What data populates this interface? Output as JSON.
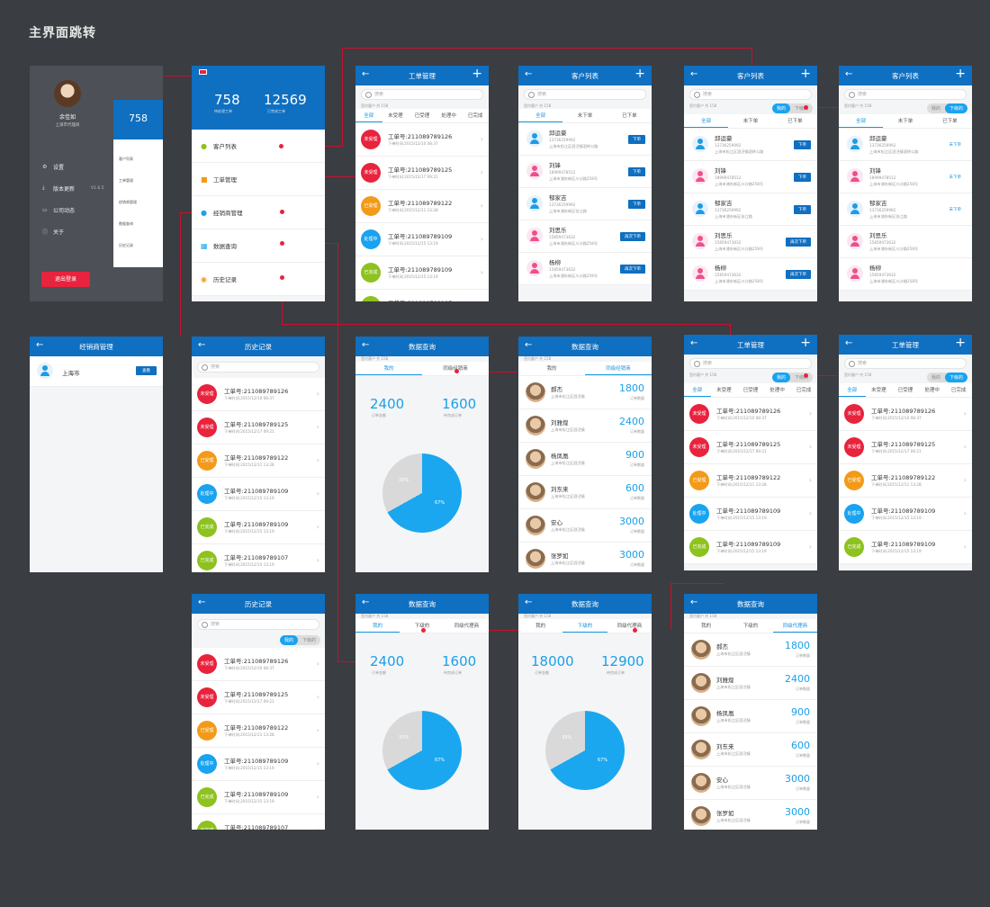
{
  "title": "主界面跳转",
  "side": {
    "name": "余佳如",
    "location": "上海市代理商",
    "menu": [
      {
        "icon": "gear-icon",
        "label": "设置"
      },
      {
        "icon": "download-icon",
        "label": "版本更新",
        "extra": "V1.6.5"
      },
      {
        "icon": "doc-icon",
        "label": "公司动态"
      },
      {
        "icon": "info-icon",
        "label": "关于"
      }
    ],
    "logout": "退出登录",
    "peek_num": "758",
    "peek_items": [
      "客户列表",
      "工单管理",
      "经销商管理",
      "数据查询",
      "历史记录"
    ]
  },
  "home": {
    "stat1": "758",
    "stat1_label": "待处理工单",
    "stat2": "12569",
    "stat2_label": "已完成工单",
    "menu": [
      "客户列表",
      "工单管理",
      "经销商管理",
      "数据查询",
      "历史记录"
    ]
  },
  "titles": {
    "work": "工单管理",
    "customers": "客户列表",
    "dealer": "经销商管理",
    "history": "历史记录",
    "data": "数据查询"
  },
  "search": "搜索",
  "sub_note": "签约客户 共 158",
  "work_tabs": [
    "全部",
    "未受理",
    "已受理",
    "处理中",
    "已完成"
  ],
  "cust_tabs": [
    "全部",
    "未下单",
    "已下单"
  ],
  "seg": [
    "我的",
    "下级的"
  ],
  "data_tabs2": [
    "我的",
    "同级经销商"
  ],
  "data_tabs3": [
    "我的",
    "下级的",
    "同级代理商"
  ],
  "orders": [
    {
      "status": "未受理",
      "no": "工单号:211089789126",
      "date": "下单时间:2015/12/10 08:37"
    },
    {
      "status": "未受理",
      "no": "工单号:211089789125",
      "date": "下单时间:2015/12/17 09:21"
    },
    {
      "status": "已受理",
      "no": "工单号:211089789122",
      "date": "下单时间:2015/12/11 13:28"
    },
    {
      "status": "处理中",
      "no": "工单号:211089789109",
      "date": "下单时间:2015/12/15 13:19"
    },
    {
      "status": "已完成",
      "no": "工单号:211089789109",
      "date": "下单时间:2015/12/15 13:19"
    },
    {
      "status": "已完成",
      "no": "工单号:211089789107",
      "date": "下单时间:2015/12/15 13:19"
    }
  ],
  "customers": [
    {
      "name": "邱运豪",
      "phone": "13736259992",
      "addr": "上海市松江区泗泾镇泗砖公路",
      "btn": "下单",
      "g": "m"
    },
    {
      "name": "刘锋",
      "phone": "18999478512",
      "addr": "上海市浦东新区川沙路258号",
      "btn": "下单",
      "g": "f"
    },
    {
      "name": "郁家吉",
      "phone": "13736259992",
      "addr": "上海市浦东新区张江路",
      "btn": "下单",
      "g": "m"
    },
    {
      "name": "刘思乐",
      "phone": "15859473632",
      "addr": "上海市浦东新区川沙路258号",
      "btn": "再次下单",
      "g": "f"
    },
    {
      "name": "杨柳",
      "phone": "15859473632",
      "addr": "上海市浦东新区川沙路258号",
      "btn": "再次下单",
      "g": "f"
    }
  ],
  "dealer_row": {
    "name": "上海市",
    "btn": "查看"
  },
  "faces": [
    {
      "name": "郝杰",
      "addr": "上海市松江区泗泾镇",
      "val": "1800"
    },
    {
      "name": "刘雅煌",
      "addr": "上海市松江区泗泾镇",
      "val": "2400"
    },
    {
      "name": "杨凤凰",
      "addr": "上海市松江区泗泾镇",
      "val": "900"
    },
    {
      "name": "刘东来",
      "addr": "上海市松江区泗泾镇",
      "val": "600"
    },
    {
      "name": "安心",
      "addr": "上海市松江区泗泾镇",
      "val": "3000"
    },
    {
      "name": "张罗如",
      "addr": "上海市松江区泗泾镇",
      "val": "3000"
    }
  ],
  "face_unit": "订单数量",
  "data_a": {
    "v1": "2400",
    "l1": "订单金额",
    "v2": "1600",
    "l2": "待完成订单",
    "p1": "33%",
    "p2": "67%"
  },
  "data_b": {
    "v1": "18000",
    "l1": "订单金额",
    "v2": "12900",
    "l2": "待完成订单",
    "p1": "33%",
    "p2": "67%"
  }
}
